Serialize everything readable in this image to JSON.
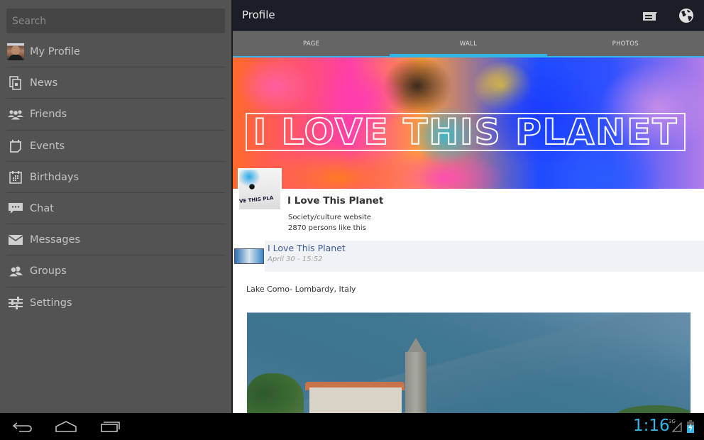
{
  "sidebar": {
    "search_placeholder": "Search",
    "items": [
      {
        "label": "My Profile",
        "icon": "avatar"
      },
      {
        "label": "News",
        "icon": "news-icon"
      },
      {
        "label": "Friends",
        "icon": "friends-icon"
      },
      {
        "label": "Events",
        "icon": "events-icon"
      },
      {
        "label": "Birthdays",
        "icon": "birthdays-icon"
      },
      {
        "label": "Chat",
        "icon": "chat-icon"
      },
      {
        "label": "Messages",
        "icon": "messages-icon"
      },
      {
        "label": "Groups",
        "icon": "groups-icon"
      },
      {
        "label": "Settings",
        "icon": "settings-icon"
      }
    ]
  },
  "actionbar": {
    "title": "Profile",
    "icons": [
      "compose-icon",
      "globe-icon"
    ]
  },
  "tabs": [
    {
      "label": "PAGE",
      "active": false
    },
    {
      "label": "WALL",
      "active": true
    },
    {
      "label": "PHOTOS",
      "active": false
    }
  ],
  "cover": {
    "text": "I LOVE THIS PLANET"
  },
  "page": {
    "name": "I Love This Planet",
    "category": "Society/culture website",
    "likes": "2870 persons like this",
    "avatar_caption": "VE THIS PLA"
  },
  "post": {
    "author": "I Love This Planet",
    "time": "April 30 - 15:52",
    "text": "Lake Como- Lombardy, Italy"
  },
  "system": {
    "time": "1:16",
    "network": "3G"
  },
  "colors": {
    "accent": "#33b5e5",
    "link": "#3b5998",
    "sidebar_bg": "#535353",
    "actionbar_bg": "#1b1e26"
  }
}
